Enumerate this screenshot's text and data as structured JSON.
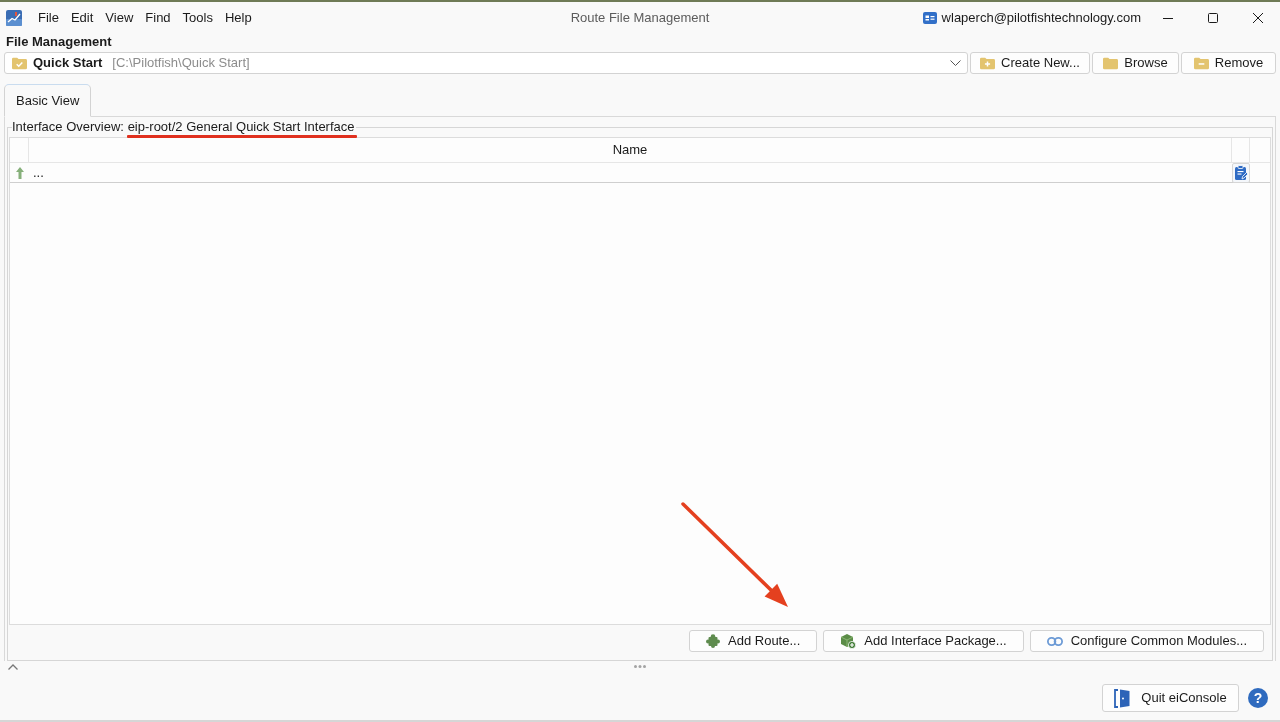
{
  "window": {
    "title": "Route File Management",
    "account": "wlaperch@pilotfishtechnology.com"
  },
  "menu": [
    "File",
    "Edit",
    "View",
    "Find",
    "Tools",
    "Help"
  ],
  "file_management": {
    "heading": "File Management",
    "selector": {
      "name": "Quick Start",
      "path": "[C:\\Pilotfish\\Quick Start]"
    },
    "buttons": [
      "Create New...",
      "Browse",
      "Remove"
    ]
  },
  "tabs": [
    {
      "label": "Basic View",
      "selected": true
    }
  ],
  "interface_overview": {
    "label": "Interface Overview:",
    "interface": "eip-root/2 General Quick Start Interface",
    "table": {
      "columns": [
        "Name"
      ],
      "rows": [
        {
          "name": "..."
        }
      ]
    },
    "buttons": [
      "Add Route...",
      "Add Interface Package...",
      "Configure Common Modules..."
    ]
  },
  "footer": {
    "quit_button": "Quit eiConsole",
    "help_button": "?"
  }
}
